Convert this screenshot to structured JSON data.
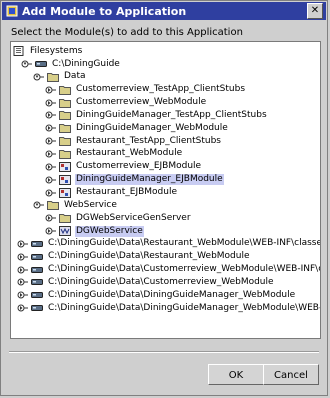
{
  "window": {
    "title": "Add Module to Application",
    "prompt": "Select the Module(s) to add to this Application",
    "close_glyph": "✕"
  },
  "tree": {
    "root": "Filesystems",
    "items": [
      {
        "label": "C:\\DiningGuide",
        "level": 1,
        "icon": "drive-icon",
        "handle": "expanded",
        "selected": false
      },
      {
        "label": "Data",
        "level": 2,
        "icon": "folder-icon",
        "handle": "expanded",
        "selected": false
      },
      {
        "label": "Customerreview_TestApp_ClientStubs",
        "level": 3,
        "icon": "folder-icon",
        "handle": "collapsed",
        "selected": false
      },
      {
        "label": "Customerreview_WebModule",
        "level": 3,
        "icon": "folder-icon",
        "handle": "collapsed",
        "selected": false
      },
      {
        "label": "DiningGuideManager_TestApp_ClientStubs",
        "level": 3,
        "icon": "folder-icon",
        "handle": "collapsed",
        "selected": false
      },
      {
        "label": "DiningGuideManager_WebModule",
        "level": 3,
        "icon": "folder-icon",
        "handle": "collapsed",
        "selected": false
      },
      {
        "label": "Restaurant_TestApp_ClientStubs",
        "level": 3,
        "icon": "folder-icon",
        "handle": "collapsed",
        "selected": false
      },
      {
        "label": "Restaurant_WebModule",
        "level": 3,
        "icon": "folder-icon",
        "handle": "collapsed",
        "selected": false
      },
      {
        "label": "Customerreview_EJBModule",
        "level": 3,
        "icon": "module-icon",
        "handle": "collapsed",
        "selected": false
      },
      {
        "label": "DiningGuideManager_EJBModule",
        "level": 3,
        "icon": "module-icon",
        "handle": "collapsed",
        "selected": true
      },
      {
        "label": "Restaurant_EJBModule",
        "level": 3,
        "icon": "module-icon",
        "handle": "collapsed",
        "selected": false
      },
      {
        "label": "WebService",
        "level": 2,
        "icon": "folder-icon",
        "handle": "expanded",
        "selected": false
      },
      {
        "label": "DGWebServiceGenServer",
        "level": 3,
        "icon": "folder-icon",
        "handle": "collapsed",
        "selected": false
      },
      {
        "label": "DGWebService",
        "level": 3,
        "icon": "webservice-icon",
        "handle": "collapsed",
        "selected": true
      },
      {
        "label": "C:\\DiningGuide\\Data\\Restaurant_WebModule\\WEB-INF\\classes",
        "level": 0,
        "icon": "drive-icon",
        "handle": "collapsed",
        "selected": false
      },
      {
        "label": "C:\\DiningGuide\\Data\\Restaurant_WebModule",
        "level": 0,
        "icon": "drive-icon",
        "handle": "collapsed",
        "selected": false
      },
      {
        "label": "C:\\DiningGuide\\Data\\Customerreview_WebModule\\WEB-INF\\classes",
        "level": 0,
        "icon": "drive-icon",
        "handle": "collapsed",
        "selected": false
      },
      {
        "label": "C:\\DiningGuide\\Data\\Customerreview_WebModule",
        "level": 0,
        "icon": "drive-icon",
        "handle": "collapsed",
        "selected": false
      },
      {
        "label": "C:\\DiningGuide\\Data\\DiningGuideManager_WebModule",
        "level": 0,
        "icon": "drive-icon",
        "handle": "collapsed",
        "selected": false
      },
      {
        "label": "C:\\DiningGuide\\Data\\DiningGuideManager_WebModule\\WEB-INF\\classes",
        "level": 0,
        "icon": "drive-icon",
        "handle": "collapsed",
        "selected": false
      }
    ]
  },
  "buttons": {
    "ok": "OK",
    "cancel": "Cancel"
  },
  "colors": {
    "titlebar": "#2f3fa0",
    "selection": "#c8ccf2",
    "folder": "#d8cf8a",
    "drive": "#5a6e86"
  }
}
